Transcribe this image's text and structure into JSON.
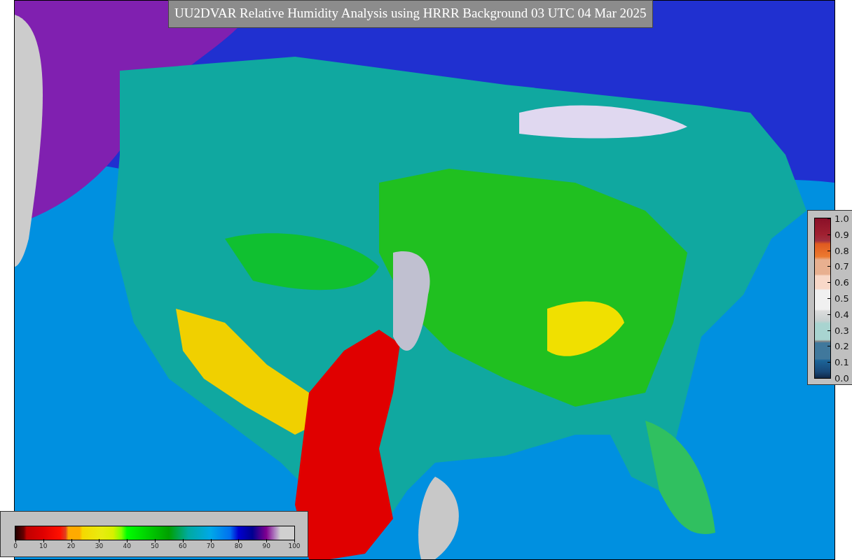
{
  "title": "UU2DVAR Relative Humidity Analysis using HRRR Background 03 UTC 04 Mar 2025",
  "humidity_legend": {
    "ticks": [
      "0",
      "10",
      "20",
      "30",
      "40",
      "50",
      "60",
      "70",
      "80",
      "90",
      "100"
    ]
  },
  "fraction_legend": {
    "ticks": [
      "1.0",
      "0.9",
      "0.8",
      "0.7",
      "0.6",
      "0.5",
      "0.4",
      "0.3",
      "0.2",
      "0.1",
      "0.0"
    ]
  }
}
